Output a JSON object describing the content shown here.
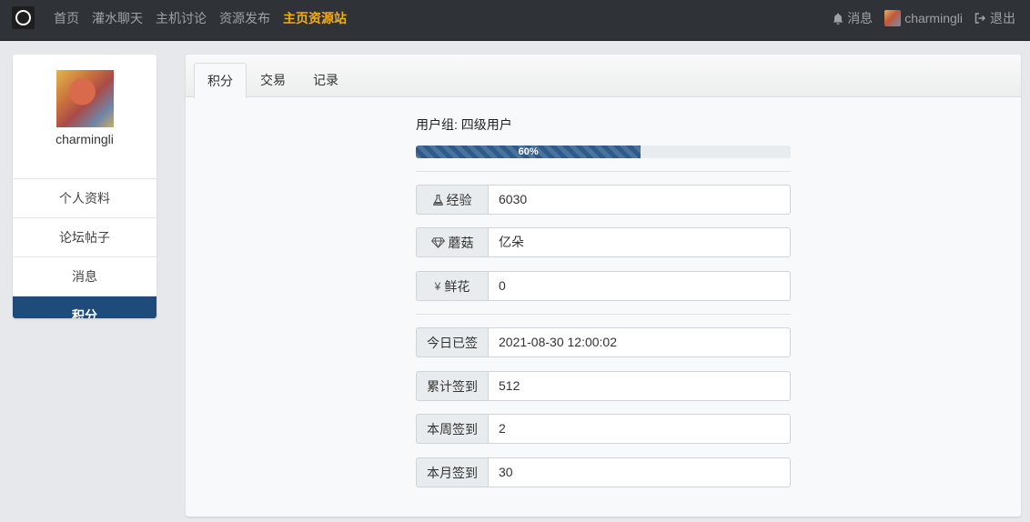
{
  "nav": {
    "items": [
      {
        "label": "首页",
        "active": false
      },
      {
        "label": "灌水聊天",
        "active": false
      },
      {
        "label": "主机讨论",
        "active": false
      },
      {
        "label": "资源发布",
        "active": false
      },
      {
        "label": "主页资源站",
        "active": true
      }
    ],
    "messages_label": "消息",
    "username": "charmingli",
    "logout_label": "退出",
    "active_color": "#f0ad1a"
  },
  "sidebar": {
    "username": "charmingli",
    "items": [
      {
        "label": "个人资料"
      },
      {
        "label": "论坛帖子"
      },
      {
        "label": "消息"
      },
      {
        "label": "积分",
        "active": true
      }
    ],
    "active_color": "#1f4b7a"
  },
  "tabs": [
    {
      "label": "积分",
      "active": true
    },
    {
      "label": "交易"
    },
    {
      "label": "记录"
    }
  ],
  "points": {
    "group_label": "用户组: 四级用户",
    "progress_text": "60%",
    "progress_value": 60,
    "stats": [
      {
        "icon": "flask-icon",
        "label": "经验",
        "value": "6030"
      },
      {
        "icon": "diamond-icon",
        "label": "蘑菇",
        "value": "亿朵"
      },
      {
        "icon": "yen-icon",
        "label": "鲜花",
        "value": "0"
      }
    ],
    "signin": [
      {
        "label": "今日已签",
        "value": "2021-08-30 12:00:02"
      },
      {
        "label": "累计签到",
        "value": "512"
      },
      {
        "label": "本周签到",
        "value": "2"
      },
      {
        "label": "本月签到",
        "value": "30"
      }
    ]
  }
}
